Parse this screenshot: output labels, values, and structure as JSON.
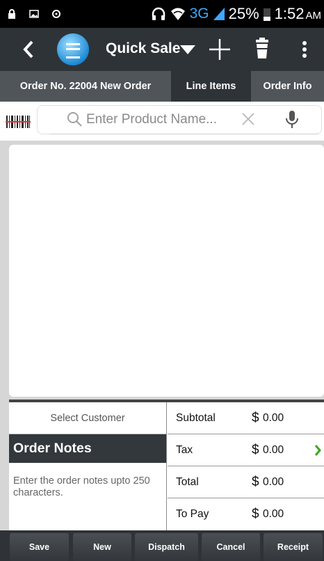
{
  "status_bar": {
    "network": "3G",
    "battery": "25%",
    "time": "1:52",
    "ampm": "AM"
  },
  "action_bar": {
    "title": "Quick Sale",
    "icons": [
      "back-arrow-icon",
      "app-logo-icon",
      "dropdown-caret-icon",
      "plus-icon",
      "trash-icon",
      "overflow-menu-icon"
    ]
  },
  "tabs": [
    {
      "label": "Order No. 22004 New Order",
      "active": false
    },
    {
      "label": "Line Items",
      "active": true
    },
    {
      "label": "Order Info",
      "active": false
    }
  ],
  "search": {
    "placeholder": "Enter Product Name..."
  },
  "summary": {
    "select_customer": "Select Customer",
    "notes_title": "Order Notes",
    "notes_placeholder": "Enter the order notes upto 250 characters.",
    "currency": "$",
    "rows": [
      {
        "label": "Subtotal",
        "value": "0.00"
      },
      {
        "label": "Tax",
        "value": "0.00"
      },
      {
        "label": "Total",
        "value": "0.00"
      },
      {
        "label": "To Pay",
        "value": "0.00"
      }
    ]
  },
  "buttons": [
    "Save",
    "New",
    "Dispatch",
    "Cancel",
    "Receipt"
  ],
  "colors": {
    "actionbar": "#2e3338",
    "tabs": "#505559",
    "accent_green": "#3aa81e",
    "network_blue": "#3ea7ff"
  }
}
